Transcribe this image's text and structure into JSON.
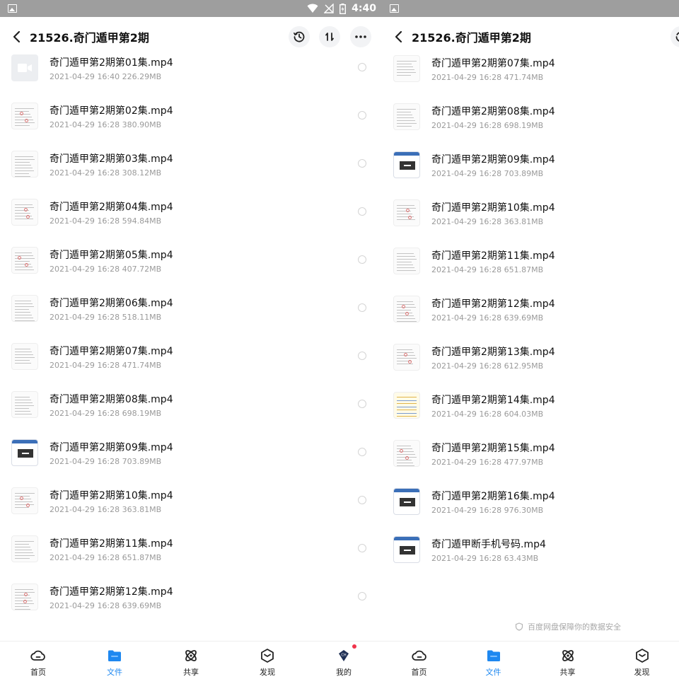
{
  "left": {
    "status_bar": {
      "time": "4:40"
    },
    "header": {
      "title": "21526.奇门遁甲第2期"
    },
    "files": [
      {
        "name": "奇门遁甲第2期第01集.mp4",
        "date": "2021-04-29",
        "time": "16:40",
        "size": "226.29MB",
        "thumb": "video"
      },
      {
        "name": "奇门遁甲第2期第02集.mp4",
        "date": "2021-04-29",
        "time": "16:28",
        "size": "380.90MB",
        "thumb": "doc-red"
      },
      {
        "name": "奇门遁甲第2期第03集.mp4",
        "date": "2021-04-29",
        "time": "16:28",
        "size": "308.12MB",
        "thumb": "doc"
      },
      {
        "name": "奇门遁甲第2期第04集.mp4",
        "date": "2021-04-29",
        "time": "16:28",
        "size": "594.84MB",
        "thumb": "doc-red"
      },
      {
        "name": "奇门遁甲第2期第05集.mp4",
        "date": "2021-04-29",
        "time": "16:28",
        "size": "407.72MB",
        "thumb": "doc-red"
      },
      {
        "name": "奇门遁甲第2期第06集.mp4",
        "date": "2021-04-29",
        "time": "16:28",
        "size": "518.11MB",
        "thumb": "doc"
      },
      {
        "name": "奇门遁甲第2期第07集.mp4",
        "date": "2021-04-29",
        "time": "16:28",
        "size": "471.74MB",
        "thumb": "doc"
      },
      {
        "name": "奇门遁甲第2期第08集.mp4",
        "date": "2021-04-29",
        "time": "16:28",
        "size": "698.19MB",
        "thumb": "doc"
      },
      {
        "name": "奇门遁甲第2期第09集.mp4",
        "date": "2021-04-29",
        "time": "16:28",
        "size": "703.89MB",
        "thumb": "screen"
      },
      {
        "name": "奇门遁甲第2期第10集.mp4",
        "date": "2021-04-29",
        "time": "16:28",
        "size": "363.81MB",
        "thumb": "doc-red"
      },
      {
        "name": "奇门遁甲第2期第11集.mp4",
        "date": "2021-04-29",
        "time": "16:28",
        "size": "651.87MB",
        "thumb": "doc"
      },
      {
        "name": "奇门遁甲第2期第12集.mp4",
        "date": "2021-04-29",
        "time": "16:28",
        "size": "639.69MB",
        "thumb": "doc-red"
      }
    ],
    "tabs": [
      {
        "label": "首页",
        "icon": "home-cloud-icon",
        "active": false
      },
      {
        "label": "文件",
        "icon": "folder-icon",
        "active": true
      },
      {
        "label": "共享",
        "icon": "share-atom-icon",
        "active": false
      },
      {
        "label": "发现",
        "icon": "discover-cube-icon",
        "active": false
      },
      {
        "label": "我的",
        "icon": "profile-gem-icon",
        "active": false,
        "badge": true
      }
    ]
  },
  "right": {
    "header": {
      "title": "21526.奇门遁甲第2期"
    },
    "files": [
      {
        "name": "奇门遁甲第2期第07集.mp4",
        "date": "2021-04-29",
        "time": "16:28",
        "size": "471.74MB",
        "thumb": "doc"
      },
      {
        "name": "奇门遁甲第2期第08集.mp4",
        "date": "2021-04-29",
        "time": "16:28",
        "size": "698.19MB",
        "thumb": "doc"
      },
      {
        "name": "奇门遁甲第2期第09集.mp4",
        "date": "2021-04-29",
        "time": "16:28",
        "size": "703.89MB",
        "thumb": "screen"
      },
      {
        "name": "奇门遁甲第2期第10集.mp4",
        "date": "2021-04-29",
        "time": "16:28",
        "size": "363.81MB",
        "thumb": "doc-red"
      },
      {
        "name": "奇门遁甲第2期第11集.mp4",
        "date": "2021-04-29",
        "time": "16:28",
        "size": "651.87MB",
        "thumb": "doc"
      },
      {
        "name": "奇门遁甲第2期第12集.mp4",
        "date": "2021-04-29",
        "time": "16:28",
        "size": "639.69MB",
        "thumb": "doc-red"
      },
      {
        "name": "奇门遁甲第2期第13集.mp4",
        "date": "2021-04-29",
        "time": "16:28",
        "size": "612.95MB",
        "thumb": "doc-red"
      },
      {
        "name": "奇门遁甲第2期第14集.mp4",
        "date": "2021-04-29",
        "time": "16:28",
        "size": "604.03MB",
        "thumb": "table"
      },
      {
        "name": "奇门遁甲第2期第15集.mp4",
        "date": "2021-04-29",
        "time": "16:28",
        "size": "477.97MB",
        "thumb": "doc-red"
      },
      {
        "name": "奇门遁甲第2期第16集.mp4",
        "date": "2021-04-29",
        "time": "16:28",
        "size": "976.30MB",
        "thumb": "screen"
      },
      {
        "name": "奇门遁甲断手机号码.mp4",
        "date": "2021-04-29",
        "time": "16:28",
        "size": "63.43MB",
        "thumb": "screen"
      }
    ],
    "footer_note": "百度网盘保障你的数据安全",
    "tabs": [
      {
        "label": "首页",
        "icon": "home-cloud-icon",
        "active": false
      },
      {
        "label": "文件",
        "icon": "folder-icon",
        "active": true
      },
      {
        "label": "共享",
        "icon": "share-atom-icon",
        "active": false
      },
      {
        "label": "发现",
        "icon": "discover-cube-icon",
        "active": false
      }
    ]
  },
  "colors": {
    "accent": "#1e88f0",
    "badge": "#f0344b",
    "status_bar": "#9e9e9e",
    "meta_text": "#9a9a9a"
  }
}
